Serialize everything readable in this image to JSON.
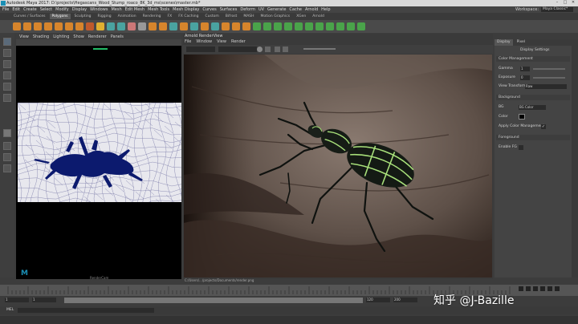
{
  "window": {
    "title": "Autodesk Maya 2017: D:\\projects\\Hegascans_Wood_Stump_roaco_8K_3d_ms\\scenes\\master.mb*"
  },
  "menubar": {
    "items": [
      "File",
      "Edit",
      "Create",
      "Select",
      "Modify",
      "Display",
      "Windows",
      "Mesh",
      "Edit Mesh",
      "Mesh Tools",
      "Mesh Display",
      "Curves",
      "Surfaces",
      "Deform",
      "UV",
      "Generate",
      "Cache",
      "Arnold",
      "Help"
    ],
    "workspace_label": "Workspace:",
    "workspace_value": "Maya Classic*"
  },
  "shelf": {
    "tabs": [
      "Curves / Surfaces",
      "Polygons",
      "Sculpting",
      "Rigging",
      "Animation",
      "Rendering",
      "FX",
      "FX Caching",
      "Custom",
      "Bifrost",
      "MASH",
      "Motion Graphics",
      "XGen",
      "Arnold"
    ],
    "active_tab": "Polygons"
  },
  "left_panel": {
    "menu": [
      "View",
      "Shading",
      "Lighting",
      "Show",
      "Renderer",
      "Panels"
    ],
    "camera_label": "RenderCam",
    "logo_letter": "M"
  },
  "render_view": {
    "title": "Arnold RenderView",
    "menu": [
      "File",
      "Window",
      "View",
      "Render"
    ],
    "status_path": "C:/Users/.../projects/Documents/render.png"
  },
  "side_panel": {
    "tabs": [
      "Display",
      "Pixel"
    ],
    "header": "Display Settings",
    "sections": {
      "color_management": "Color Management",
      "background": "Background",
      "foreground": "Foreground"
    },
    "fields": {
      "gamma_label": "Gamma",
      "gamma_value": "1",
      "exposure_label": "Exposure",
      "exposure_value": "0",
      "view_transform_label": "View Transform",
      "view_transform_value": "Raw",
      "bg_label": "BG",
      "bg_value": "BG Color",
      "color_label": "Color",
      "apply_cm_label": "Apply Color Management",
      "enable_fg_label": "Enable FG"
    }
  },
  "timeline": {
    "start": "1",
    "end": "120",
    "range_start": "1",
    "range_end": "120",
    "range_out": "200",
    "current_frame": "1"
  },
  "mel": {
    "label": "MEL"
  },
  "watermark": "知乎 @J-Bazille",
  "colors": {
    "accent": "#1a8fb5",
    "uv_bg": "#e8e8ee",
    "beetle": "#0c1a6e",
    "wood_dark": "#2a1f1a",
    "wood_mid": "#6e5e55"
  }
}
